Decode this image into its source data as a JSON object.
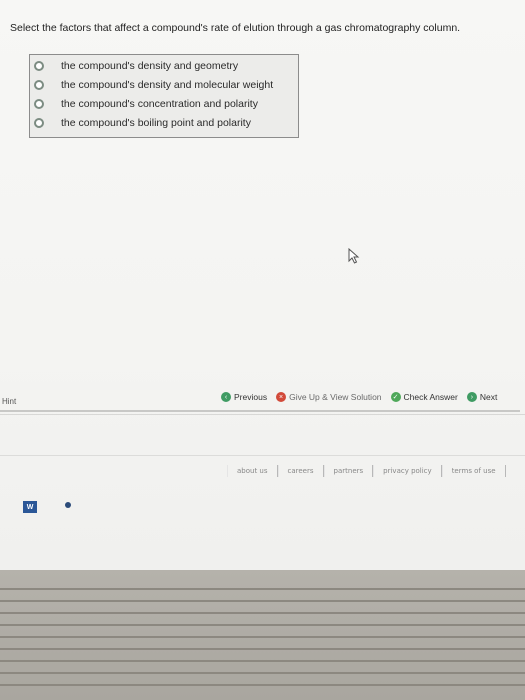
{
  "question": {
    "prompt": "Select the factors that affect a compound's rate of elution through a gas chromatography column."
  },
  "answers": [
    {
      "text": "the compound's density and geometry"
    },
    {
      "text": "the compound's density and molecular weight"
    },
    {
      "text": "the compound's concentration and polarity"
    },
    {
      "text": "the compound's boiling point and polarity"
    }
  ],
  "hint": {
    "label": "Hint"
  },
  "nav": {
    "previous": "Previous",
    "give_up": "Give Up & View Solution",
    "check_answer": "Check Answer",
    "next": "Next"
  },
  "footer": {
    "links": [
      "about us",
      "careers",
      "partners",
      "privacy policy",
      "terms of use"
    ]
  },
  "taskbar": {
    "word_icon_label": "W"
  },
  "colors": {
    "radio_border": "#7c8c82",
    "nav_green": "#3f9b63",
    "give_up_red": "#d24a3a",
    "word_blue": "#2b5797"
  }
}
